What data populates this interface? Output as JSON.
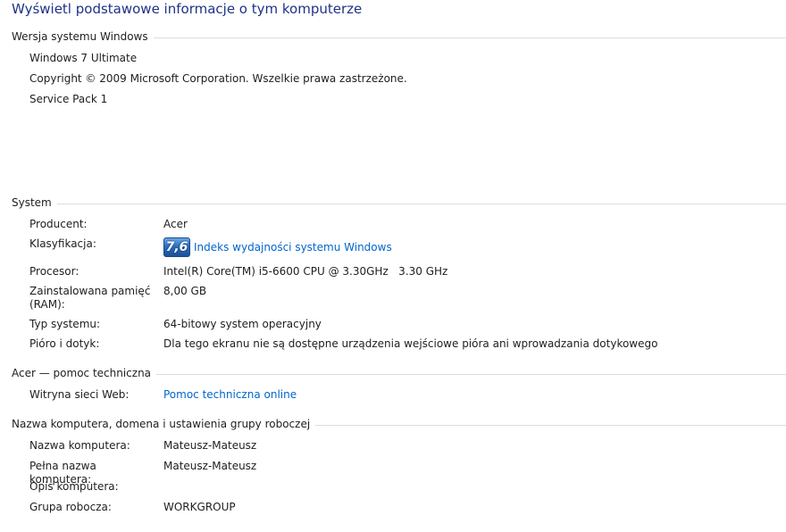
{
  "page_title": "Wyświetl podstawowe informacje o tym komputerze",
  "windows_section": {
    "header": "Wersja systemu Windows",
    "edition": "Windows 7 Ultimate",
    "copyright": "Copyright © 2009 Microsoft Corporation. Wszelkie prawa zastrzeżone.",
    "service_pack": "Service Pack 1"
  },
  "system_section": {
    "header": "System",
    "rows": [
      {
        "label": "Producent:",
        "value": "Acer"
      },
      {
        "label": "Klasyfikacja:",
        "score": "7,6",
        "link": "Indeks wydajności systemu Windows"
      },
      {
        "label": "Procesor:",
        "value": "Intel(R) Core(TM) i5-6600 CPU @ 3.30GHz   3.30 GHz"
      },
      {
        "label": "Zainstalowana pamięć (RAM):",
        "value": "8,00 GB"
      },
      {
        "label": "Typ systemu:",
        "value": "64-bitowy system operacyjny"
      },
      {
        "label": "Pióro i dotyk:",
        "value": "Dla tego ekranu nie są dostępne urządzenia wejściowe pióra ani wprowadzania dotykowego"
      }
    ]
  },
  "support_section": {
    "header": "Acer — pomoc techniczna",
    "rows": [
      {
        "label": "Witryna sieci Web:",
        "link": "Pomoc techniczna online"
      }
    ]
  },
  "computer_section": {
    "header": "Nazwa komputera, domena i ustawienia grupy roboczej",
    "rows": [
      {
        "label": "Nazwa komputera:",
        "value": "Mateusz-Mateusz"
      },
      {
        "label": "Pełna nazwa komputera:",
        "value": "Mateusz-Mateusz"
      },
      {
        "label": "Opis komputera:",
        "value": ""
      },
      {
        "label": "Grupa robocza:",
        "value": "WORKGROUP"
      }
    ]
  },
  "colors": {
    "title": "#1e3287",
    "link": "#0066cc",
    "divider": "#d5dfe5"
  }
}
